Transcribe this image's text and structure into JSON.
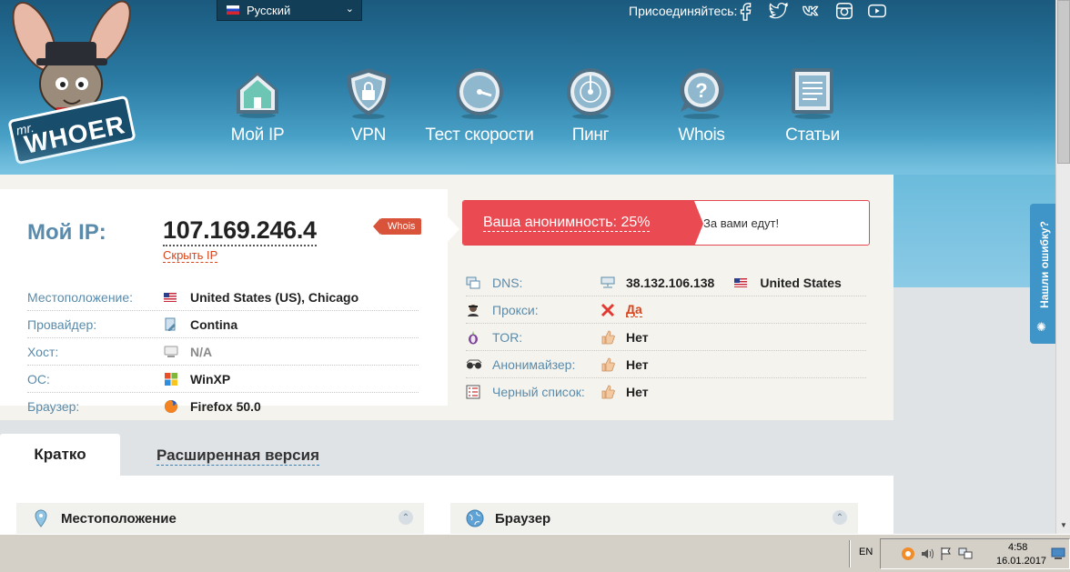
{
  "header": {
    "language": "Русский",
    "join_label": "Присоединяйтесь:",
    "socials": [
      "facebook-icon",
      "twitter-icon",
      "vk-icon",
      "instagram-icon",
      "youtube-icon"
    ],
    "logo": {
      "small": "mr.",
      "big": "WHOER"
    }
  },
  "nav": {
    "items": [
      {
        "label": "Мой IP",
        "icon": "home-icon"
      },
      {
        "label": "VPN",
        "icon": "shield-lock-icon"
      },
      {
        "label": "Тест скорости",
        "icon": "speedometer-icon"
      },
      {
        "label": "Пинг",
        "icon": "radar-icon"
      },
      {
        "label": "Whois",
        "icon": "question-icon"
      },
      {
        "label": "Статьи",
        "icon": "article-icon"
      }
    ]
  },
  "ip": {
    "label": "Мой IP:",
    "value": "107.169.246.4",
    "hide_link": "Скрыть IP",
    "whois_tag": "Whois"
  },
  "details": [
    {
      "label": "Местоположение:",
      "value": "United States (US), Chicago",
      "icon": "us-flag-icon"
    },
    {
      "label": "Провайдер:",
      "value": "Contina",
      "icon": "provider-icon"
    },
    {
      "label": "Хост:",
      "value": "N/A",
      "icon": "host-icon"
    },
    {
      "label": "ОС:",
      "value": "WinXP",
      "icon": "windows-icon"
    },
    {
      "label": "Браузер:",
      "value": "Firefox 50.0",
      "icon": "firefox-icon"
    }
  ],
  "anonymity": {
    "text": "Ваша анонимность: 25%",
    "message": "За вами едут!",
    "percent": 25
  },
  "checks": [
    {
      "label": "DNS:",
      "value": "38.132.106.138",
      "country": "United States",
      "icon": "dns-icon"
    },
    {
      "label": "Прокси:",
      "value": "Да",
      "icon": "proxy-icon",
      "status": "bad"
    },
    {
      "label": "TOR:",
      "value": "Нет",
      "icon": "tor-icon",
      "status": "good"
    },
    {
      "label": "Анонимайзер:",
      "value": "Нет",
      "icon": "anonymizer-icon",
      "status": "good"
    },
    {
      "label": "Черный список:",
      "value": "Нет",
      "icon": "blacklist-icon",
      "status": "good"
    }
  ],
  "tabs": {
    "active": "Кратко",
    "other": "Расширенная версия"
  },
  "cards": {
    "location": "Местоположение",
    "browser": "Браузер"
  },
  "report_error": "Нашли ошибку?",
  "taskbar": {
    "lang": "EN",
    "time": "4:58",
    "date": "16.01.2017"
  },
  "colors": {
    "accent_blue": "#5b8bab",
    "alert_red": "#ea4a52",
    "link_orange": "#d9441b"
  }
}
